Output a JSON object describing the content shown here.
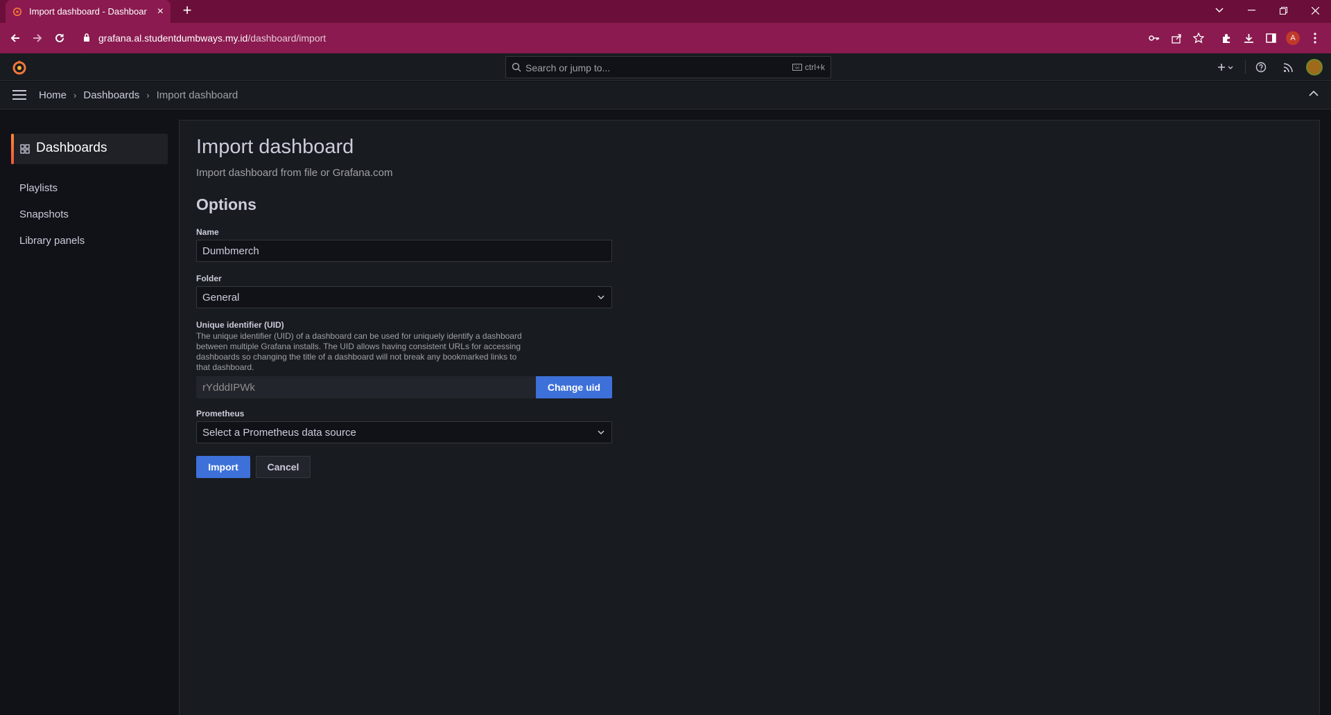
{
  "browser": {
    "tab_title": "Import dashboard - Dashboards",
    "url_host": "grafana.al.studentdumbways.my.id",
    "url_path": "/dashboard/import",
    "profile_initial": "A"
  },
  "topnav": {
    "search_placeholder": "Search or jump to...",
    "search_shortcut": "ctrl+k"
  },
  "breadcrumb": {
    "items": [
      "Home",
      "Dashboards"
    ],
    "current": "Import dashboard",
    "separator": "›"
  },
  "sidebar": {
    "active": "Dashboards",
    "items": [
      "Playlists",
      "Snapshots",
      "Library panels"
    ]
  },
  "page": {
    "title": "Import dashboard",
    "subtitle": "Import dashboard from file or Grafana.com",
    "section": "Options"
  },
  "form": {
    "name_label": "Name",
    "name_value": "Dumbmerch",
    "folder_label": "Folder",
    "folder_value": "General",
    "uid_label": "Unique identifier (UID)",
    "uid_description": "The unique identifier (UID) of a dashboard can be used for uniquely identify a dashboard between multiple Grafana installs. The UID allows having consistent URLs for accessing dashboards so changing the title of a dashboard will not break any bookmarked links to that dashboard.",
    "uid_value": "rYdddIPWk",
    "change_uid_label": "Change uid",
    "datasource_label": "Prometheus",
    "datasource_placeholder": "Select a Prometheus data source",
    "import_label": "Import",
    "cancel_label": "Cancel"
  },
  "colors": {
    "browser_accent": "#8a1a4f",
    "primary_button": "#3d71d9",
    "background": "#111217",
    "panel": "#181b1f",
    "grafana_orange": "#f5763c"
  }
}
